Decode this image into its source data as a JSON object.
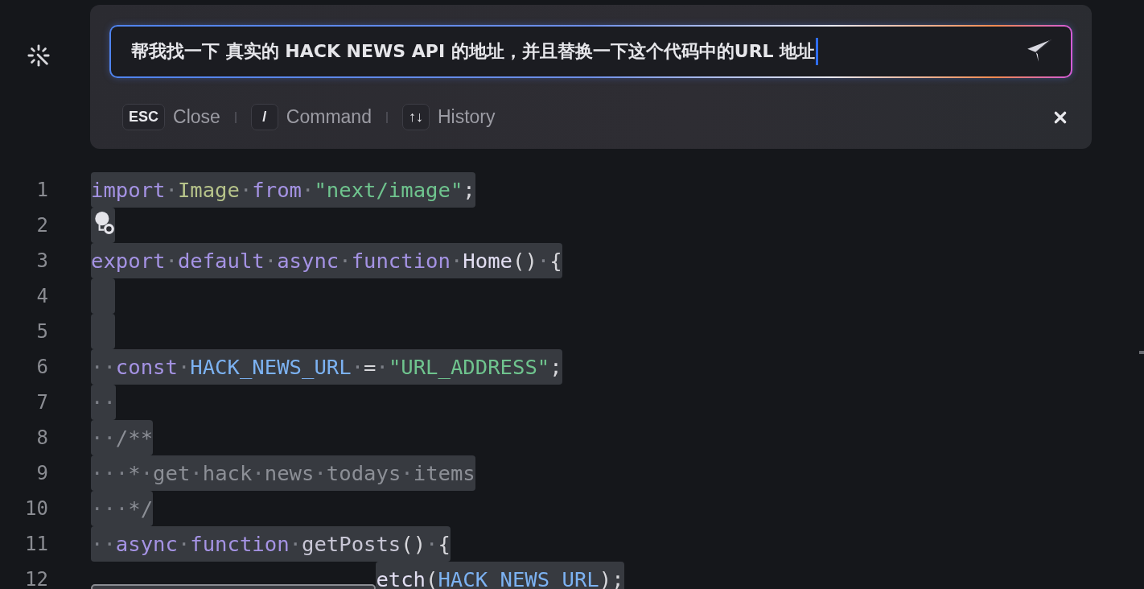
{
  "prompt": {
    "value": "帮我找一下 真实的 HACK NEWS API 的地址，并且替换一下这个代码中的URL 地址"
  },
  "shortcuts": [
    {
      "key": "ESC",
      "label": "Close"
    },
    {
      "key": "/",
      "label": "Command"
    },
    {
      "key": "↑↓",
      "label": "History"
    }
  ],
  "editor": {
    "lines": [
      {
        "number": "1",
        "selected": true,
        "tokens": [
          {
            "kind": "keyword",
            "text": "import"
          },
          {
            "kind": "whitespace",
            "text": "·"
          },
          {
            "kind": "type",
            "text": "Image"
          },
          {
            "kind": "whitespace",
            "text": "·"
          },
          {
            "kind": "keyword",
            "text": "from"
          },
          {
            "kind": "whitespace",
            "text": "·"
          },
          {
            "kind": "string",
            "text": "\"next/image\""
          },
          {
            "kind": "punct",
            "text": ";"
          }
        ]
      },
      {
        "number": "2",
        "selected": true,
        "lightbulb": true
      },
      {
        "number": "3",
        "selected": true,
        "tokens": [
          {
            "kind": "keyword",
            "text": "export"
          },
          {
            "kind": "whitespace",
            "text": "·"
          },
          {
            "kind": "keyword",
            "text": "default"
          },
          {
            "kind": "whitespace",
            "text": "·"
          },
          {
            "kind": "keyword",
            "text": "async"
          },
          {
            "kind": "whitespace",
            "text": "·"
          },
          {
            "kind": "keyword",
            "text": "function"
          },
          {
            "kind": "whitespace",
            "text": "·"
          },
          {
            "kind": "func",
            "text": "Home"
          },
          {
            "kind": "punct",
            "text": "()"
          },
          {
            "kind": "whitespace",
            "text": "·"
          },
          {
            "kind": "punct",
            "text": "{"
          }
        ]
      },
      {
        "number": "4",
        "selected": true
      },
      {
        "number": "5",
        "selected": true
      },
      {
        "number": "6",
        "selected": true,
        "tokens": [
          {
            "kind": "whitespace",
            "text": "··"
          },
          {
            "kind": "keyword",
            "text": "const"
          },
          {
            "kind": "whitespace",
            "text": "·"
          },
          {
            "kind": "variable",
            "text": "HACK_NEWS_URL"
          },
          {
            "kind": "whitespace",
            "text": "·"
          },
          {
            "kind": "punct",
            "text": "="
          },
          {
            "kind": "whitespace",
            "text": "·"
          },
          {
            "kind": "string",
            "text": "\"URL_ADDRESS\""
          },
          {
            "kind": "punct",
            "text": ";"
          }
        ]
      },
      {
        "number": "7",
        "selected": true,
        "tokens": [
          {
            "kind": "whitespace",
            "text": "··"
          }
        ]
      },
      {
        "number": "8",
        "selected": true,
        "tokens": [
          {
            "kind": "whitespace",
            "text": "··"
          },
          {
            "kind": "comment",
            "text": "/**"
          }
        ]
      },
      {
        "number": "9",
        "selected": true,
        "tokens": [
          {
            "kind": "whitespace",
            "text": "···"
          },
          {
            "kind": "comment",
            "text": "*"
          },
          {
            "kind": "whitespace",
            "text": "·"
          },
          {
            "kind": "comment",
            "text": "get"
          },
          {
            "kind": "whitespace",
            "text": "·"
          },
          {
            "kind": "comment",
            "text": "hack"
          },
          {
            "kind": "whitespace",
            "text": "·"
          },
          {
            "kind": "comment",
            "text": "news"
          },
          {
            "kind": "whitespace",
            "text": "·"
          },
          {
            "kind": "comment",
            "text": "todays"
          },
          {
            "kind": "whitespace",
            "text": "·"
          },
          {
            "kind": "comment",
            "text": "items"
          }
        ]
      },
      {
        "number": "10",
        "selected": true,
        "tokens": [
          {
            "kind": "whitespace",
            "text": "···"
          },
          {
            "kind": "comment",
            "text": "*/"
          }
        ]
      },
      {
        "number": "11",
        "selected": true,
        "tokens": [
          {
            "kind": "whitespace",
            "text": "··"
          },
          {
            "kind": "keyword",
            "text": "async"
          },
          {
            "kind": "whitespace",
            "text": "·"
          },
          {
            "kind": "keyword",
            "text": "function"
          },
          {
            "kind": "whitespace",
            "text": "·"
          },
          {
            "kind": "method",
            "text": "getPosts"
          },
          {
            "kind": "punct",
            "text": "()"
          },
          {
            "kind": "whitespace",
            "text": "·"
          },
          {
            "kind": "punct",
            "text": "{"
          }
        ]
      },
      {
        "number": "12",
        "selected": true,
        "tokens": [
          {
            "kind": "func",
            "text": "etch"
          },
          {
            "kind": "punct",
            "text": "("
          },
          {
            "kind": "variable",
            "text": "HACK_NEWS_URL"
          },
          {
            "kind": "punct",
            "text": ");"
          }
        ]
      }
    ]
  }
}
